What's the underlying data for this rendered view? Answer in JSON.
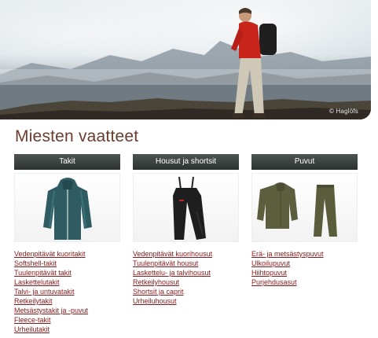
{
  "hero": {
    "credit": "© Haglöfs"
  },
  "page": {
    "title": "Miesten vaatteet"
  },
  "columns": [
    {
      "header": "Takit",
      "image_icon": "jacket-icon",
      "links": [
        "Vedenpitävät kuoritakit",
        "Softshell-takit",
        "Tuulenpitävät takit",
        "Laskettelutakit",
        "Talvi- ja untuvatakit",
        "Retkeilytakit",
        "Metsästystakit ja -puvut",
        "Fleece-takit",
        "Urheilutakit"
      ]
    },
    {
      "header": "Housut ja shortsit",
      "image_icon": "pants-icon",
      "links": [
        "Vedenpitävät kuorihousut",
        "Tuulenpitävät housut",
        "Laskettelu- ja talvihousut",
        "Retkeilyhousut",
        "Shortsit ja caprit",
        "Urheiluhousut"
      ]
    },
    {
      "header": "Puvut",
      "image_icon": "suit-icon",
      "links": [
        "Erä- ja metsästyspuvut",
        "Ulkoilupuvut",
        "Hiihtopuvut",
        "Purjehdusasut"
      ]
    }
  ],
  "colors": {
    "title": "#6a3c2d",
    "link": "#8a1a1a",
    "header_bg": "#3a403d"
  }
}
